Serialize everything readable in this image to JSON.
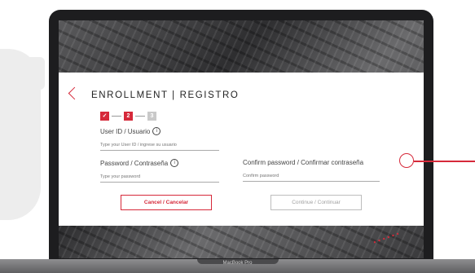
{
  "colors": {
    "accent": "#d6293a",
    "muted": "#c9c9c9"
  },
  "form": {
    "title": "ENROLLMENT | REGISTRO",
    "steps": [
      {
        "label": "✓",
        "state": "done"
      },
      {
        "label": "2",
        "state": "active"
      },
      {
        "label": "3",
        "state": "pending"
      }
    ],
    "user_id": {
      "label": "User ID / Usuario",
      "placeholder": "Type your User ID / ingrese su usuario"
    },
    "password": {
      "label": "Password / Contraseña",
      "placeholder": "Type your password"
    },
    "confirm": {
      "label": "Confirm password / Confirmar contraseña",
      "placeholder": "Confirm password"
    },
    "cancel_label": "Cancel / Cancelar",
    "continue_label": "Continue / Continuar"
  },
  "device": {
    "brand": "MacBook Pro"
  },
  "icons": {
    "back": "chevron-left-icon",
    "info": "info-icon"
  }
}
